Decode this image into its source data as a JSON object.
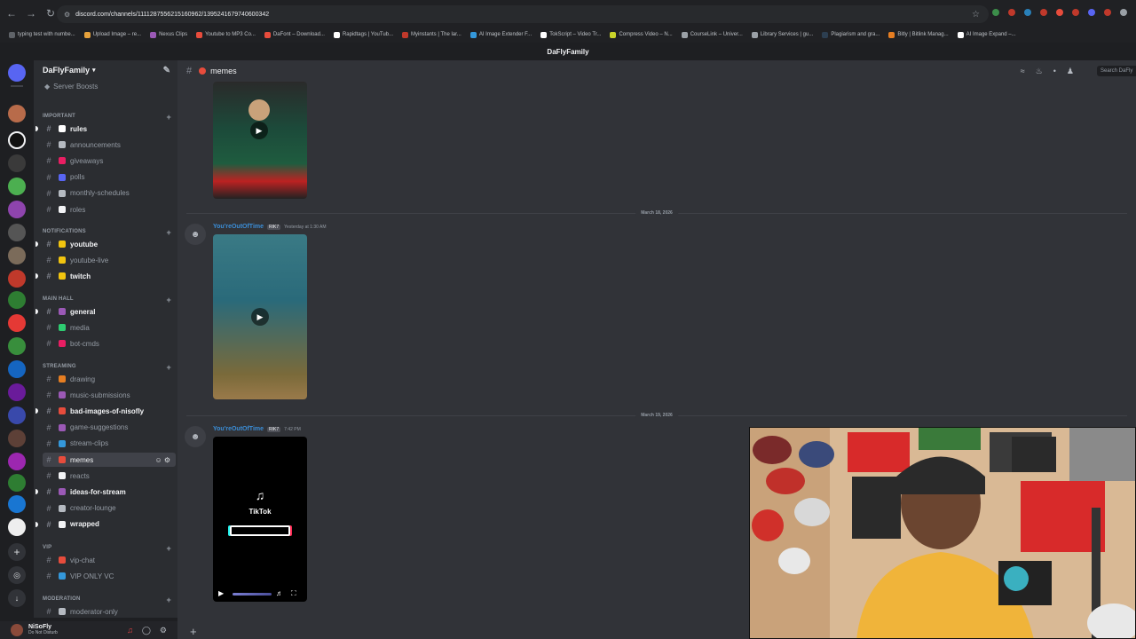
{
  "browser": {
    "url": "discord.com/channels/1111287556215160962/1395241679740600342",
    "bookmarks": [
      {
        "label": "typing test with numbe...",
        "color": "#5f6368"
      },
      {
        "label": "Upload Image – re...",
        "color": "#e6a23c"
      },
      {
        "label": "Nexus Clips",
        "color": "#9b59b6"
      },
      {
        "label": "Youtube to MP3 Co...",
        "color": "#e74c3c"
      },
      {
        "label": "DaFont – Download...",
        "color": "#e74c3c"
      },
      {
        "label": "Rapidtags | YouTub...",
        "color": "#ffffff"
      },
      {
        "label": "Myinstants | The lar...",
        "color": "#c0392b"
      },
      {
        "label": "AI Image Extender F...",
        "color": "#3498db"
      },
      {
        "label": "TokScript – Video Tr...",
        "color": "#ffffff"
      },
      {
        "label": "Compress Video – N...",
        "color": "#c9d32a"
      },
      {
        "label": "CourseLink – Univer...",
        "color": "#9aa0a6"
      },
      {
        "label": "Library Services | gu...",
        "color": "#9aa0a6"
      },
      {
        "label": "Plagiarism and gra...",
        "color": "#2c3e50"
      },
      {
        "label": "Bitly | Bitlink Manag...",
        "color": "#e67e22"
      },
      {
        "label": "AI Image Expand –...",
        "color": "#ffffff"
      }
    ]
  },
  "server": {
    "title": "DaFlyFamily",
    "name": "DaFlyFamily",
    "boosts": "Server Boosts"
  },
  "categories": [
    {
      "label": "IMPORTANT",
      "channels": [
        {
          "name": "rules",
          "unread": true,
          "color": "#ffffff"
        },
        {
          "name": "announcements",
          "unread": false,
          "color": "#b5bac1"
        },
        {
          "name": "giveaways",
          "unread": false,
          "color": "#e91e63"
        },
        {
          "name": "polls",
          "unread": false,
          "color": "#5865f2"
        },
        {
          "name": "monthly-schedules",
          "unread": false,
          "color": "#b5bac1"
        },
        {
          "name": "roles",
          "unread": false,
          "color": "#f2f3f5"
        }
      ]
    },
    {
      "label": "NOTIFICATIONS",
      "channels": [
        {
          "name": "youtube",
          "unread": true,
          "color": "#f1c40f"
        },
        {
          "name": "youtube-live",
          "unread": false,
          "color": "#f1c40f"
        },
        {
          "name": "twitch",
          "unread": true,
          "color": "#f1c40f"
        }
      ]
    },
    {
      "label": "MAIN HALL",
      "channels": [
        {
          "name": "general",
          "unread": true,
          "color": "#9b59b6"
        },
        {
          "name": "media",
          "unread": false,
          "color": "#2ecc71"
        },
        {
          "name": "bot-cmds",
          "unread": false,
          "color": "#e91e63"
        }
      ]
    },
    {
      "label": "STREAMING",
      "channels": [
        {
          "name": "drawing",
          "unread": false,
          "color": "#e67e22"
        },
        {
          "name": "music-submissions",
          "unread": false,
          "color": "#9b59b6"
        },
        {
          "name": "bad-images-of-nisofly",
          "unread": true,
          "color": "#e74c3c"
        },
        {
          "name": "game-suggestions",
          "unread": false,
          "color": "#9b59b6"
        },
        {
          "name": "stream-clips",
          "unread": false,
          "color": "#3498db"
        },
        {
          "name": "memes",
          "unread": false,
          "active": true,
          "color": "#e74c3c"
        },
        {
          "name": "reacts",
          "unread": false,
          "color": "#f2f3f5"
        },
        {
          "name": "ideas-for-stream",
          "unread": true,
          "color": "#9b59b6"
        },
        {
          "name": "creator-lounge",
          "unread": false,
          "color": "#b5bac1"
        },
        {
          "name": "wrapped",
          "unread": true,
          "color": "#f2f3f5"
        }
      ]
    },
    {
      "label": "VIP",
      "channels": [
        {
          "name": "vip-chat",
          "unread": false,
          "color": "#e74c3c"
        },
        {
          "name": "VIP ONLY VC",
          "unread": false,
          "color": "#3498db"
        }
      ]
    },
    {
      "label": "MODERATION",
      "channels": [
        {
          "name": "moderator-only",
          "unread": false,
          "color": "#b5bac1"
        }
      ]
    }
  ],
  "channel": {
    "name": "memes",
    "search_placeholder": "Search DaFly"
  },
  "messages": [
    {
      "date": "March 18, 2026",
      "author": "You'reOutOfTime",
      "tag": "RIK7",
      "timestamp": "Yesterday at 1:30 AM"
    },
    {
      "date": "March 19, 2026",
      "author": "You'reOutOfTime",
      "tag": "RIK7",
      "timestamp": "7:42 PM"
    }
  ],
  "video_card": {
    "brand": "TikTok"
  },
  "user": {
    "name": "NiSoFly",
    "status": "Do Not Disturb"
  },
  "icons": {
    "rail": [
      "discord-home",
      "server-avatars",
      "add-server",
      "discover",
      "download"
    ],
    "header": [
      "threads-icon",
      "bell-icon",
      "pin-icon",
      "members-icon"
    ]
  },
  "colors": {
    "accent": "#5865f2",
    "bg_main": "#313338",
    "bg_sidebar": "#2b2d31",
    "bg_rail": "#1e1f22"
  }
}
